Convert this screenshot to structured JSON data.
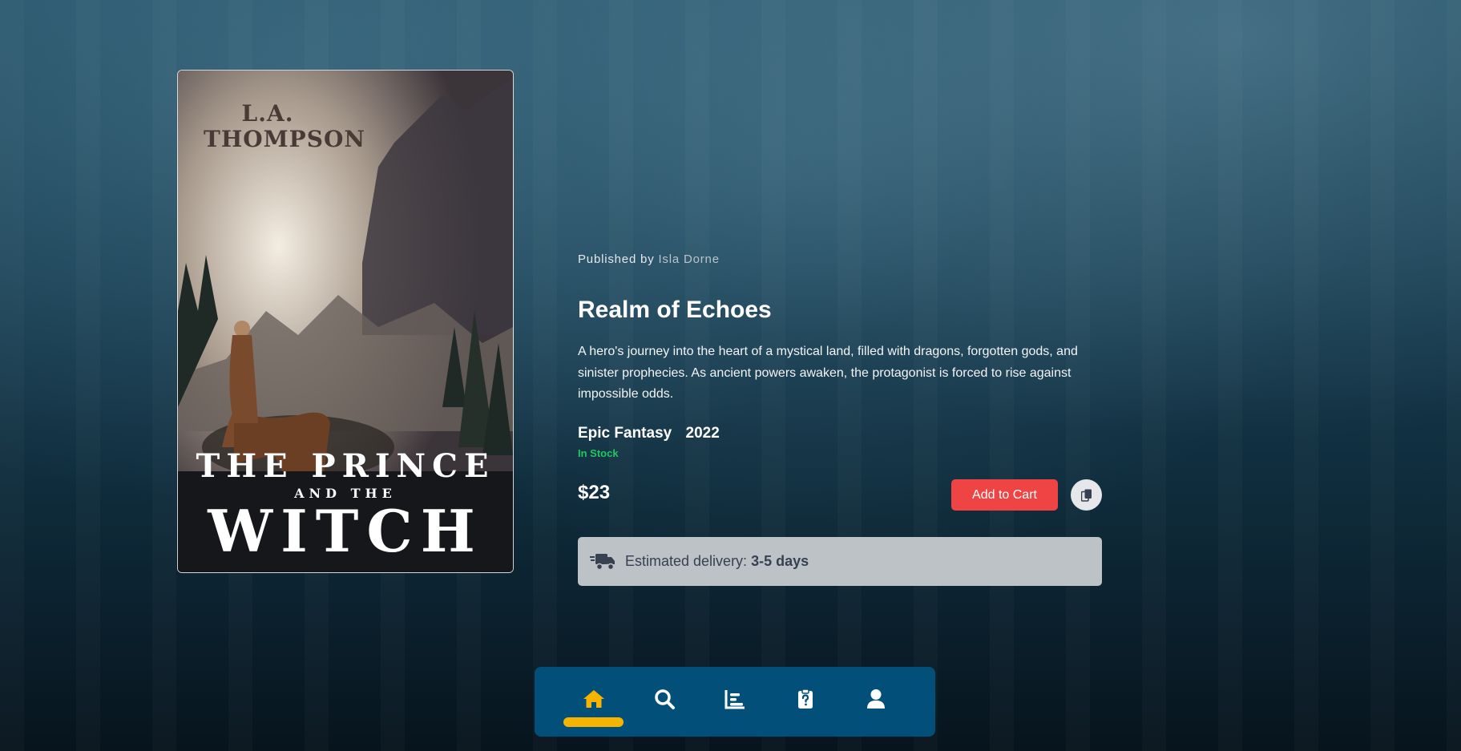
{
  "book": {
    "cover": {
      "author_text": "L.A.\nTHOMPSON",
      "title_line1": "THE PRINCE",
      "title_line2": "AND THE",
      "title_line3": "WITCH"
    },
    "publisher_prefix": "Published by",
    "publisher_name": "Isla Dorne",
    "title": "Realm of Echoes",
    "description": "A hero's journey into the heart of a mystical land, filled with dragons, forgotten gods, and sinister prophecies. As ancient powers awaken, the protagonist is forced to rise against impossible odds.",
    "genre": "Epic Fantasy",
    "year": "2022",
    "stock_status": "In Stock",
    "price": "$23"
  },
  "actions": {
    "add_to_cart_label": "Add to Cart",
    "copy_icon": "copy-icon"
  },
  "delivery": {
    "prefix": "Estimated delivery:",
    "value": "3-5 days",
    "icon": "truck-icon"
  },
  "nav": {
    "items": [
      {
        "name": "home",
        "icon": "home-icon",
        "active": true
      },
      {
        "name": "search",
        "icon": "search-icon",
        "active": false
      },
      {
        "name": "stats",
        "icon": "bar-chart-icon",
        "active": false
      },
      {
        "name": "orders",
        "icon": "clipboard-question-icon",
        "active": false
      },
      {
        "name": "profile",
        "icon": "user-icon",
        "active": false
      }
    ],
    "active_color": "#f5b400",
    "background": "#02507a"
  },
  "colors": {
    "accent_red": "#ef4444",
    "in_stock_green": "#22c55e"
  }
}
